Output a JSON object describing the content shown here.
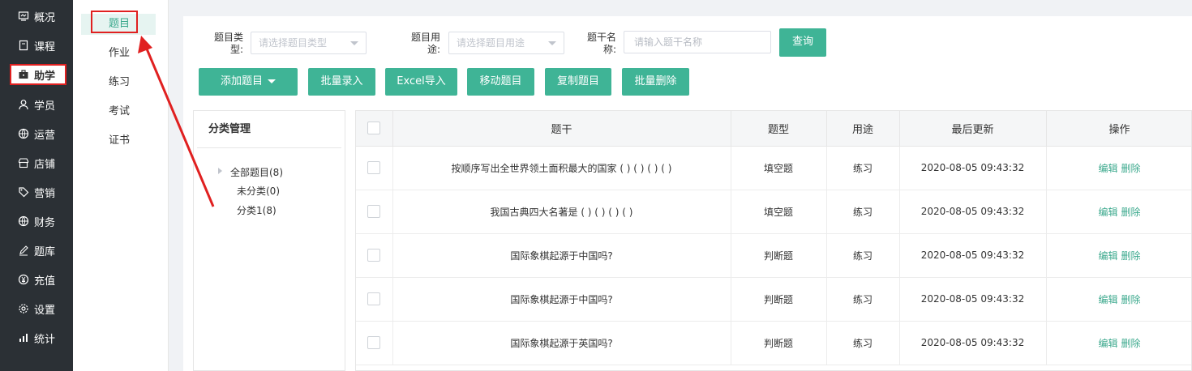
{
  "sidebar": {
    "items": [
      {
        "label": "概况",
        "icon": "overview-icon"
      },
      {
        "label": "课程",
        "icon": "book-icon"
      },
      {
        "label": "助学",
        "icon": "briefcase-icon"
      },
      {
        "label": "学员",
        "icon": "user-icon"
      },
      {
        "label": "运营",
        "icon": "globe-icon"
      },
      {
        "label": "店铺",
        "icon": "store-icon"
      },
      {
        "label": "营销",
        "icon": "tag-icon"
      },
      {
        "label": "财务",
        "icon": "globe-icon"
      },
      {
        "label": "题库",
        "icon": "pen-icon"
      },
      {
        "label": "充值",
        "icon": "yen-icon"
      },
      {
        "label": "设置",
        "icon": "gear-icon"
      },
      {
        "label": "统计",
        "icon": "bar-chart-icon"
      }
    ],
    "active_index": 2
  },
  "subnav": {
    "items": [
      "题目",
      "作业",
      "练习",
      "考试",
      "证书"
    ],
    "active_index": 0
  },
  "filters": {
    "type_label": "题目类型:",
    "type_placeholder": "请选择题目类型",
    "use_label": "题目用途:",
    "use_placeholder": "请选择题目用途",
    "stem_label": "题干名称:",
    "stem_placeholder": "请输入题干名称",
    "query_button": "查询"
  },
  "toolbar": {
    "add": "添加题目",
    "batch_input": "批量录入",
    "excel_import": "Excel导入",
    "move": "移动题目",
    "copy": "复制题目",
    "batch_delete": "批量删除"
  },
  "categories": {
    "title": "分类管理",
    "root": "全部题目(8)",
    "children": [
      "未分类(0)",
      "分类1(8)"
    ]
  },
  "table": {
    "columns": [
      "题干",
      "题型",
      "用途",
      "最后更新",
      "操作"
    ],
    "edit_label": "编辑",
    "delete_label": "删除",
    "rows": [
      {
        "stem": "按顺序写出全世界领土面积最大的国家 ( ) ( ) ( ) ( )",
        "type": "填空题",
        "use": "练习",
        "updated": "2020-08-05 09:43:32"
      },
      {
        "stem": "我国古典四大名著是 ( ) ( ) ( ) ( )",
        "type": "填空题",
        "use": "练习",
        "updated": "2020-08-05 09:43:32"
      },
      {
        "stem": "国际象棋起源于中国吗?",
        "type": "判断题",
        "use": "练习",
        "updated": "2020-08-05 09:43:32"
      },
      {
        "stem": "国际象棋起源于中国吗?",
        "type": "判断题",
        "use": "练习",
        "updated": "2020-08-05 09:43:32"
      },
      {
        "stem": "国际象棋起源于英国吗?",
        "type": "判断题",
        "use": "练习",
        "updated": "2020-08-05 09:43:32"
      }
    ]
  },
  "colors": {
    "primary": "#3fb496",
    "sidebar_bg": "#2b3035",
    "annotation_red": "#e02020"
  }
}
